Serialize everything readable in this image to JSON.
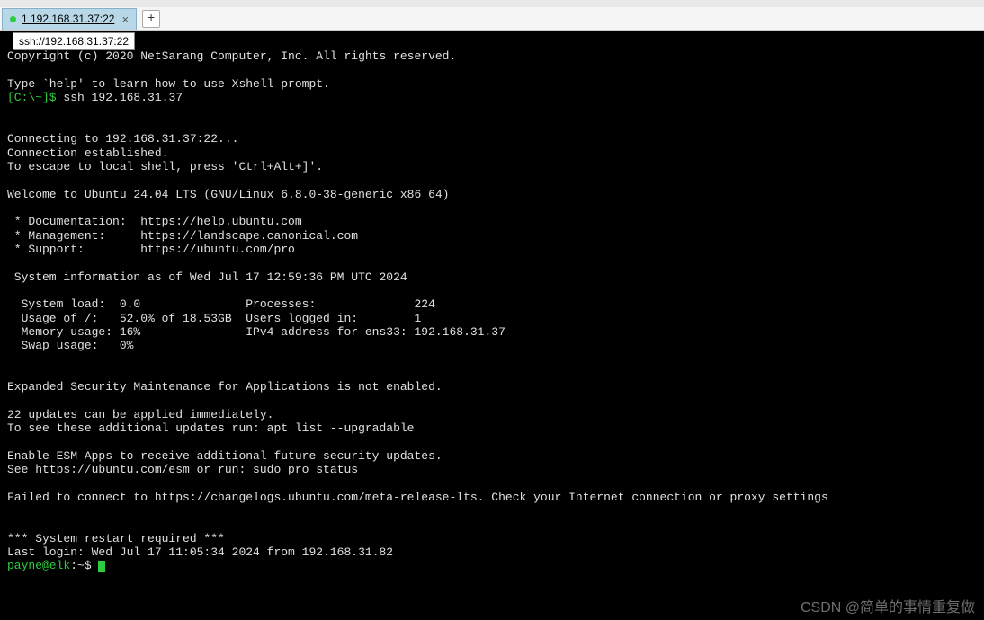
{
  "tab": {
    "label": "1 192.168.31.37:22",
    "close": "×"
  },
  "addTab": "+",
  "tooltip": "ssh://192.168.31.37:22",
  "term": {
    "copyright": "Copyright (c) 2020 NetSarang Computer, Inc. All rights reserved.",
    "helpLine": "Type `help' to learn how to use Xshell prompt.",
    "promptLocal": "[C:\\~]$ ",
    "sshCmd": "ssh 192.168.31.37",
    "connecting": "Connecting to 192.168.31.37:22...",
    "established": "Connection established.",
    "escape": "To escape to local shell, press 'Ctrl+Alt+]'.",
    "welcome": "Welcome to Ubuntu 24.04 LTS (GNU/Linux 6.8.0-38-generic x86_64)",
    "doc": " * Documentation:  https://help.ubuntu.com",
    "mgmt": " * Management:     https://landscape.canonical.com",
    "support": " * Support:        https://ubuntu.com/pro",
    "sysinfo": " System information as of Wed Jul 17 12:59:36 PM UTC 2024",
    "row1": "  System load:  0.0               Processes:              224",
    "row2": "  Usage of /:   52.0% of 18.53GB  Users logged in:        1",
    "row3": "  Memory usage: 16%               IPv4 address for ens33: 192.168.31.37",
    "row4": "  Swap usage:   0%",
    "esm1": "Expanded Security Maintenance for Applications is not enabled.",
    "updates1": "22 updates can be applied immediately.",
    "updates2": "To see these additional updates run: apt list --upgradable",
    "esm2": "Enable ESM Apps to receive additional future security updates.",
    "esm3": "See https://ubuntu.com/esm or run: sudo pro status",
    "fail": "Failed to connect to https://changelogs.ubuntu.com/meta-release-lts. Check your Internet connection or proxy settings",
    "restart": "*** System restart required ***",
    "lastLogin": "Last login: Wed Jul 17 11:05:34 2024 from 192.168.31.82",
    "promptUserHost": "payne@elk",
    "promptPath": ":~$ "
  },
  "watermark": "CSDN @简单的事情重复做"
}
